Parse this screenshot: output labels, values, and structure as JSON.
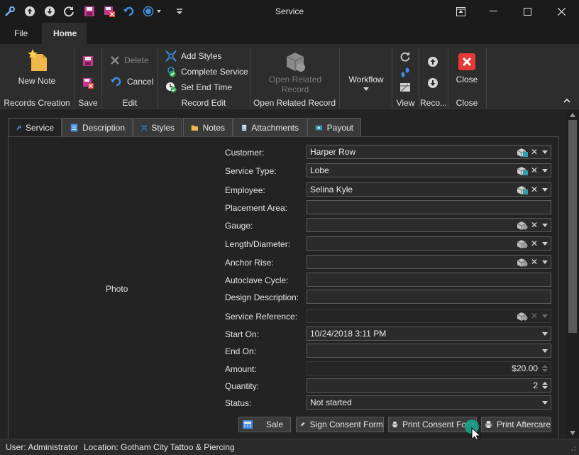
{
  "window": {
    "title": "Service"
  },
  "quick_access": [
    "tools-icon",
    "arrow-up-circle-icon",
    "arrow-down-circle-icon",
    "refresh-icon",
    "save-icon",
    "save-close-icon",
    "undo-icon",
    "record-dot-icon",
    "customize-dropdown-icon"
  ],
  "ribbon_tabs": [
    {
      "label": "File"
    },
    {
      "label": "Home"
    }
  ],
  "ribbon": {
    "records_creation": {
      "new_note": "New Note",
      "label": "Records Creation"
    },
    "save": {
      "label": "Save"
    },
    "edit": {
      "delete": "Delete",
      "cancel": "Cancel",
      "label": "Edit"
    },
    "record_edit": {
      "add_styles": "Add Styles",
      "complete_service": "Complete Service",
      "set_end_time": "Set End Time",
      "label": "Record Edit"
    },
    "open_related": {
      "button_line1": "Open Related",
      "button_line2": "Record",
      "label": "Open Related Record"
    },
    "workflow": {
      "label": "Workflow"
    },
    "view": {
      "label": "View"
    },
    "records": {
      "label": "Reco..."
    },
    "close": {
      "button": "Close",
      "label": "Close"
    }
  },
  "form_tabs": [
    {
      "label": "Service",
      "icon": "tools-icon"
    },
    {
      "label": "Description",
      "icon": "document-icon"
    },
    {
      "label": "Styles",
      "icon": "styles-icon"
    },
    {
      "label": "Notes",
      "icon": "folder-icon"
    },
    {
      "label": "Attachments",
      "icon": "attachment-icon"
    },
    {
      "label": "Payout",
      "icon": "payout-icon"
    }
  ],
  "photo_label": "Photo",
  "fields": {
    "customer": {
      "label": "Customer:",
      "value": "Harper Row"
    },
    "service_type": {
      "label": "Service Type:",
      "value": "Lobe"
    },
    "employee": {
      "label": "Employee:",
      "value": "Selina Kyle"
    },
    "placement_area": {
      "label": "Placement Area:",
      "value": ""
    },
    "gauge": {
      "label": "Gauge:",
      "value": ""
    },
    "length_diameter": {
      "label": "Length/Diameter:",
      "value": ""
    },
    "anchor_rise": {
      "label": "Anchor Rise:",
      "value": ""
    },
    "autoclave_cycle": {
      "label": "Autoclave Cycle:",
      "value": ""
    },
    "design_description": {
      "label": "Design Description:",
      "value": ""
    },
    "service_reference": {
      "label": "Service Reference:",
      "value": ""
    },
    "start_on": {
      "label": "Start On:",
      "value": "10/24/2018 3:11 PM"
    },
    "end_on": {
      "label": "End On:",
      "value": ""
    },
    "amount": {
      "label": "Amount:",
      "value": "$20.00"
    },
    "quantity": {
      "label": "Quantity:",
      "value": "2"
    },
    "status": {
      "label": "Status:",
      "value": "Not started"
    }
  },
  "actions": {
    "sale": "Sale",
    "sign_consent": "Sign Consent Form",
    "print_consent": "Print Consent Form",
    "print_aftercare": "Print Aftercare"
  },
  "statusbar": {
    "user": "User: Administrator",
    "location": "Location: Gotham City Tattoo & Piercing"
  },
  "colors": {
    "accent_blue": "#1e88e5",
    "close_red": "#e53935",
    "save_purple": "#c0398f",
    "cursor_teal": "#1aa08a"
  }
}
